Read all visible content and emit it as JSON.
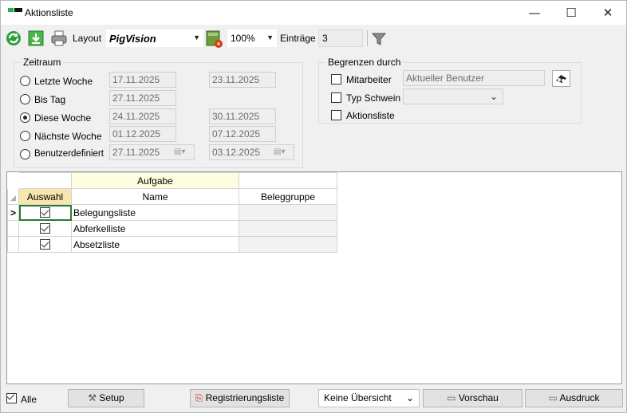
{
  "window": {
    "title": "Aktionsliste",
    "minimize": "—",
    "maximize": "☐",
    "close": "✕"
  },
  "toolbar": {
    "layout_label": "Layout",
    "layout_value": "PigVision",
    "zoom_value": "100%",
    "entries_label": "Einträge",
    "entries_value": "3"
  },
  "zeitraum": {
    "title": "Zeitraum",
    "options": [
      {
        "label": "Letzte Woche",
        "from": "17.11.2025",
        "to": "23.11.2025",
        "selected": false
      },
      {
        "label": "Bis Tag",
        "from": "27.11.2025",
        "to": "",
        "selected": false
      },
      {
        "label": "Diese Woche",
        "from": "24.11.2025",
        "to": "30.11.2025",
        "selected": true
      },
      {
        "label": "Nächste Woche",
        "from": "01.12.2025",
        "to": "07.12.2025",
        "selected": false
      },
      {
        "label": "Benutzerdefiniert",
        "from": "27.11.2025",
        "to": "03.12.2025",
        "selected": false
      }
    ]
  },
  "begrenzen": {
    "title": "Begrenzen durch",
    "mitarbeiter_label": "Mitarbeiter",
    "mitarbeiter_value": "Aktueller Benutzer",
    "typ_label": "Typ Schwein",
    "aktionsliste_label": "Aktionsliste"
  },
  "grid": {
    "group_header": "Aufgabe",
    "columns": [
      "Auswahl",
      "Name",
      "Beleggruppe"
    ],
    "row_indicator": ">",
    "rows": [
      {
        "checked": true,
        "name": "Belegungsliste",
        "beleggruppe": ""
      },
      {
        "checked": true,
        "name": "Abferkelliste",
        "beleggruppe": ""
      },
      {
        "checked": true,
        "name": "Absetzliste",
        "beleggruppe": ""
      }
    ]
  },
  "bottom": {
    "alle_label": "Alle",
    "setup_label": "Setup",
    "registrierungsliste_label": "Registrierungsliste",
    "overview_value": "Keine Übersicht",
    "vorschau_label": "Vorschau",
    "ausdruck_label": "Ausdruck"
  }
}
